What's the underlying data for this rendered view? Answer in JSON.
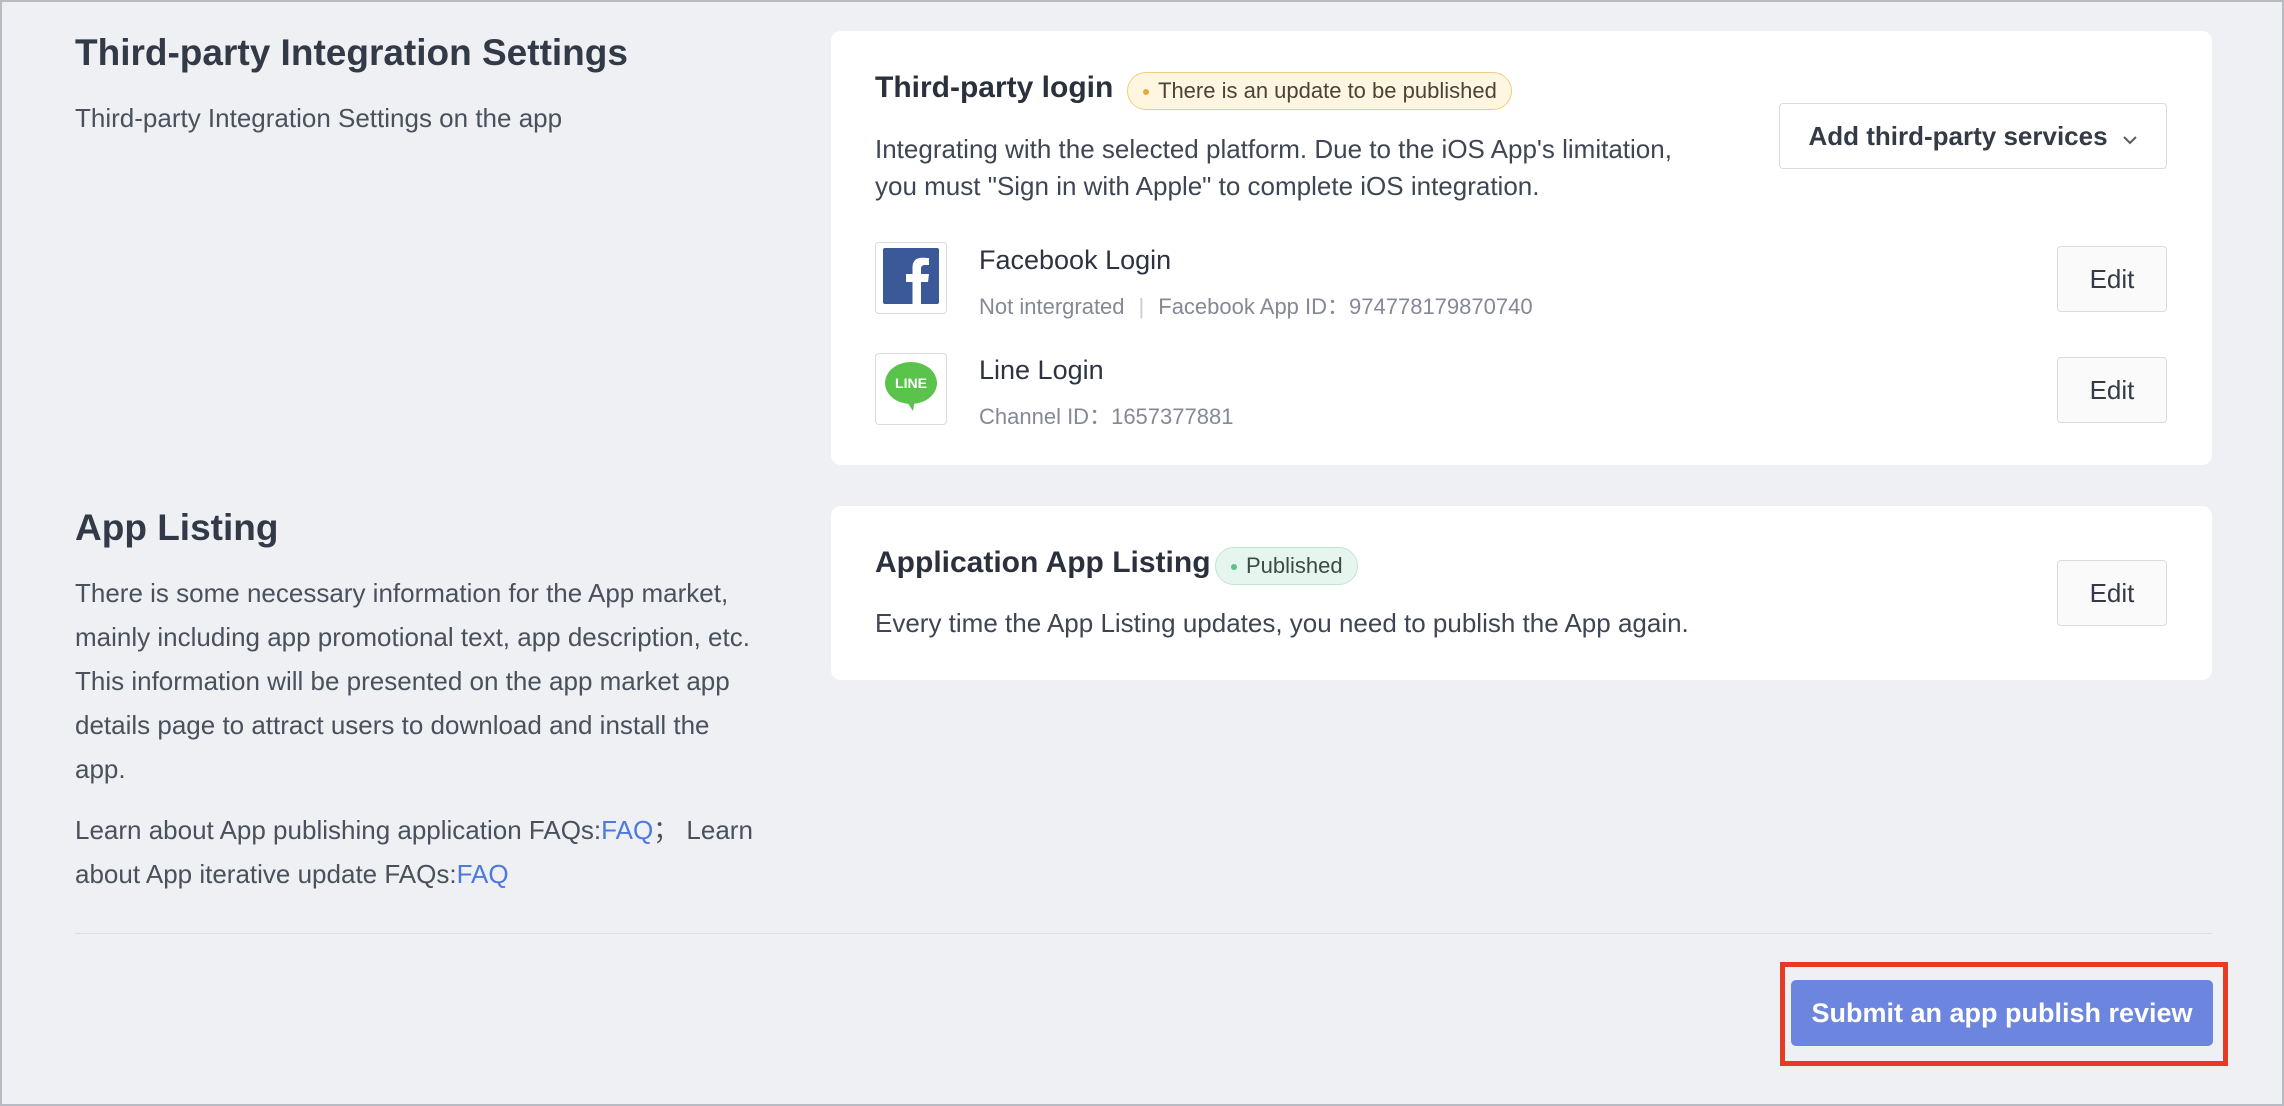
{
  "integration_section": {
    "title": "Third-party Integration Settings",
    "description": "Third-party Integration Settings on the app"
  },
  "third_party_login": {
    "title": "Third-party login",
    "badge": "There is an update to be published",
    "description_line1": "Integrating with the selected platform. Due to the iOS App's limitation,",
    "description_line2": "you must \"Sign in with Apple\" to complete iOS integration.",
    "add_button_label": "Add third-party services",
    "integrations": [
      {
        "name": "Facebook Login",
        "status": "Not intergrated",
        "id_label": "Facebook App ID：",
        "id_value": "974778179870740",
        "icon": "facebook-icon",
        "edit_label": "Edit"
      },
      {
        "name": "Line Login",
        "id_label": "Channel ID：",
        "id_value": "1657377881",
        "icon": "line-icon",
        "icon_text": "LINE",
        "edit_label": "Edit"
      }
    ]
  },
  "app_listing_section": {
    "title": "App Listing",
    "description": [
      "There is some necessary information for the App market,",
      "mainly including app promotional text, app description, etc.",
      "This information will be presented on the app market app",
      "details page to attract users to download and install the",
      "app."
    ],
    "faq_text_1": "Learn about App publishing application FAQs:",
    "faq_link_1": "FAQ",
    "faq_sep": "；",
    "faq_text_2a": "Learn",
    "faq_text_2b": "about App iterative update FAQs:",
    "faq_link_2": "FAQ"
  },
  "app_listing_card": {
    "title": "Application App Listing",
    "badge": "Published",
    "description": "Every time the App Listing updates, you need to publish the App again.",
    "edit_label": "Edit"
  },
  "submit_button_label": "Submit an app publish review",
  "colors": {
    "primary": "#6c86e0",
    "highlight": "#e53b25",
    "warning_badge": "#fff6e1",
    "success_badge": "#e6f6ee",
    "link": "#4d78e0",
    "facebook": "#3b5998",
    "line": "#5ac34c"
  }
}
